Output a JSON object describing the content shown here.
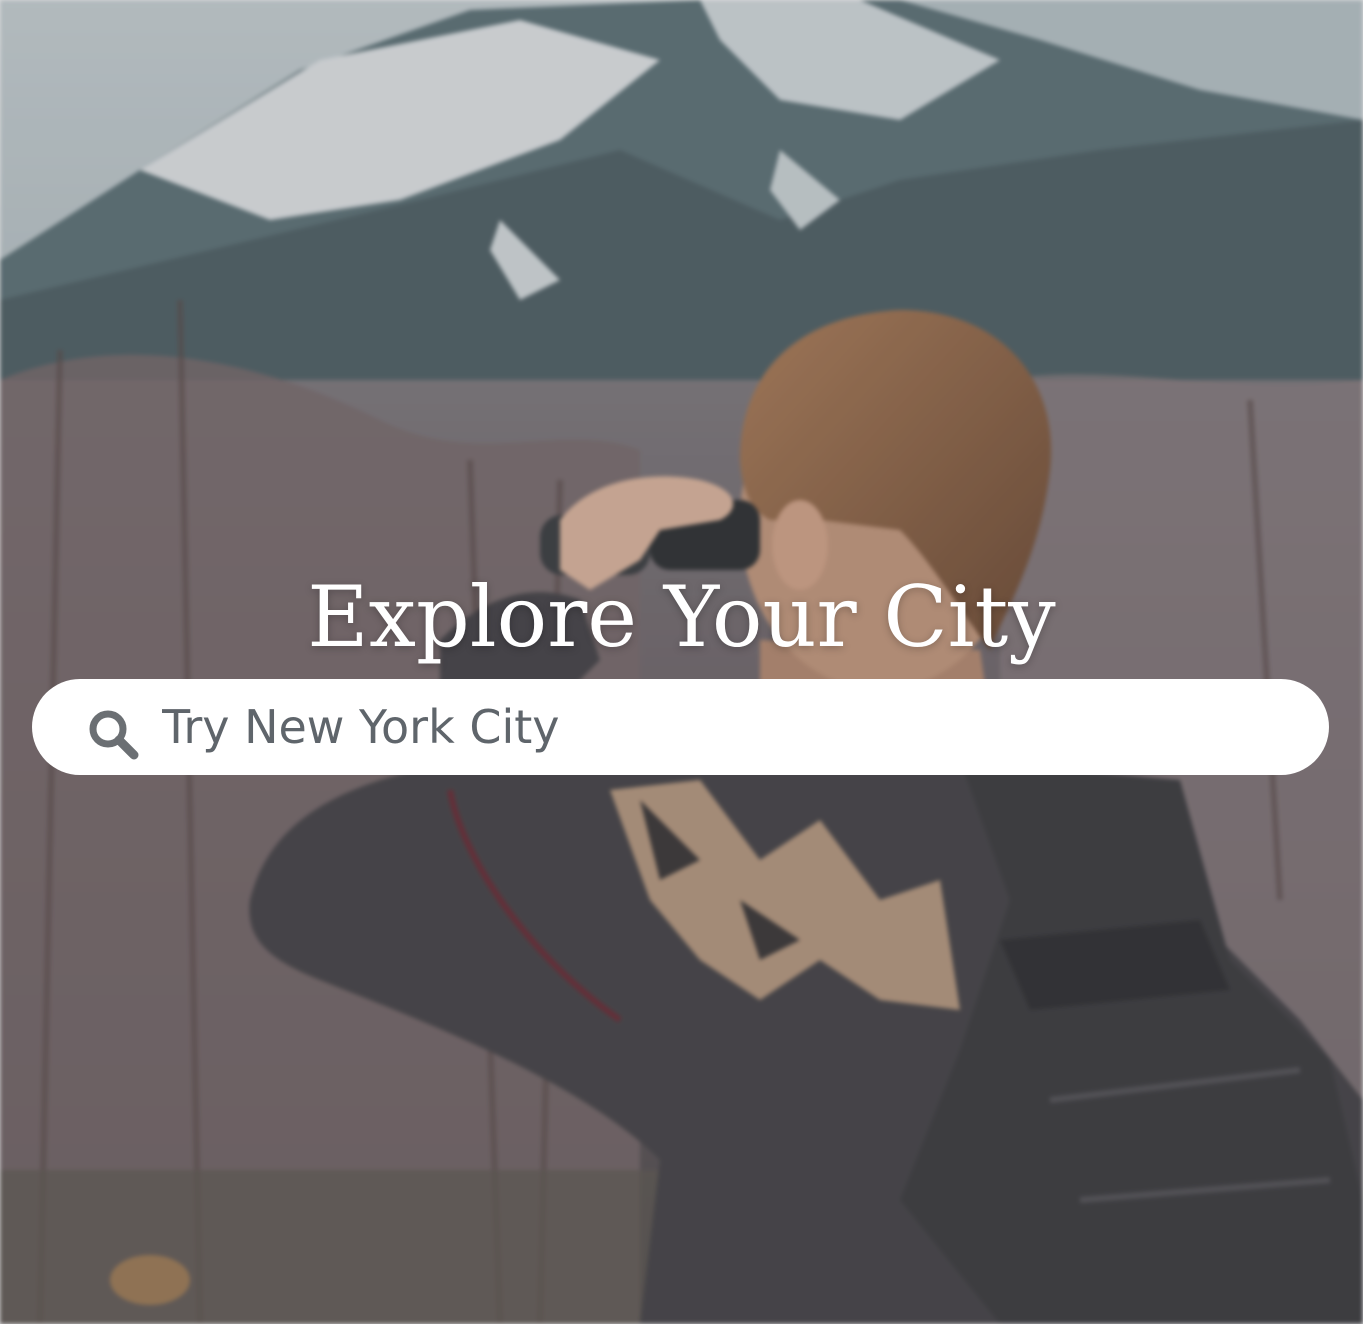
{
  "hero": {
    "title": "Explore Your City",
    "background": "hiker-with-binoculars-photo"
  },
  "search": {
    "placeholder": "Try New York City",
    "value": "",
    "icon": "search-icon"
  },
  "colors": {
    "title_text": "#ffffff",
    "search_bg": "#ffffff",
    "placeholder_text": "#5f656b",
    "icon_color": "#6b6f73"
  }
}
